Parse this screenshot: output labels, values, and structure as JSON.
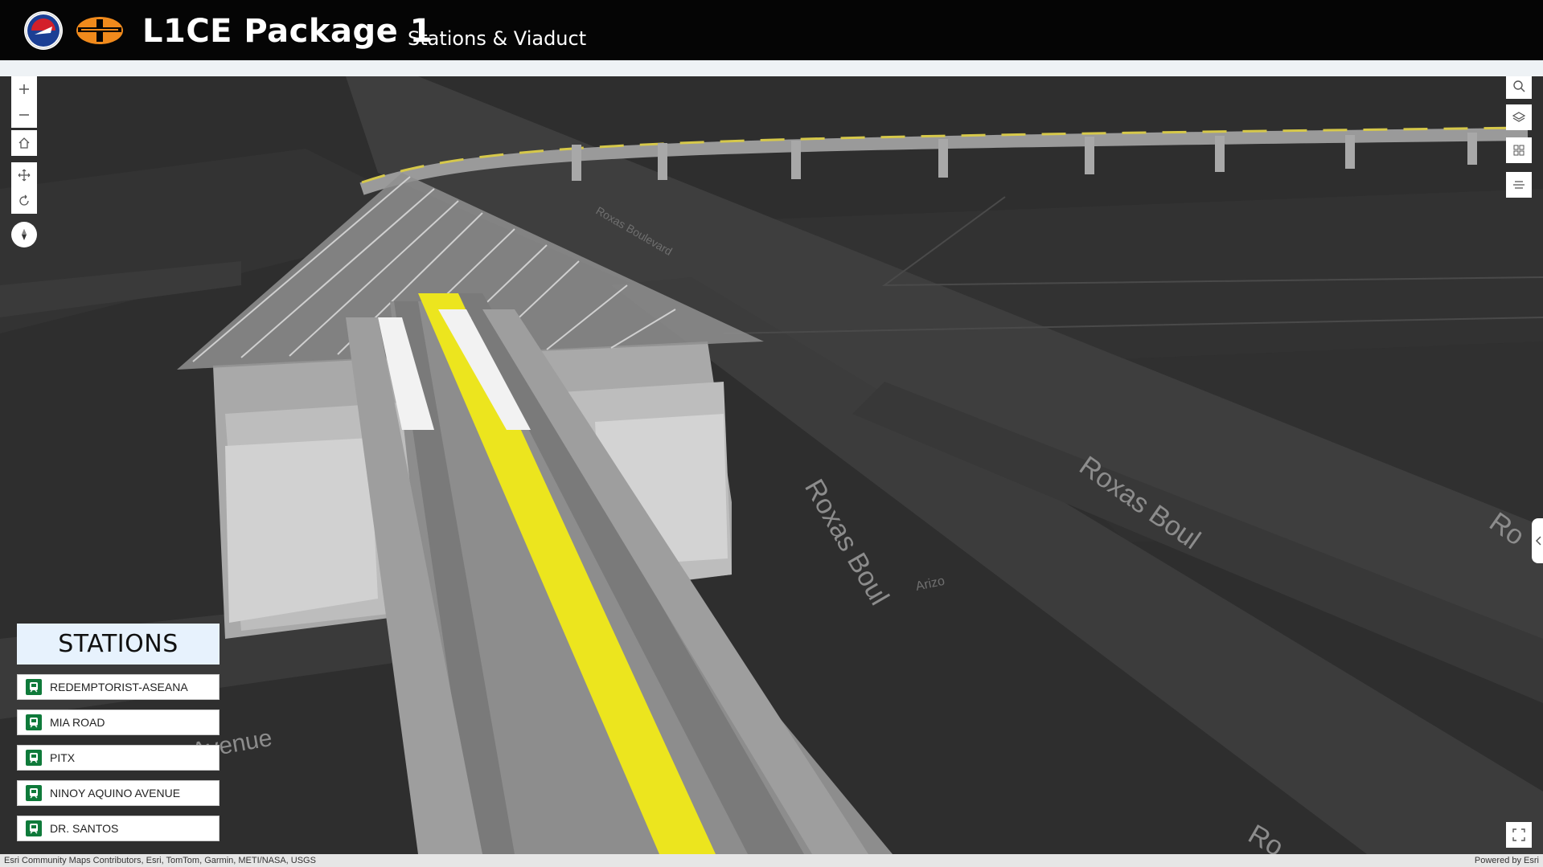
{
  "header": {
    "title": "L1CE Package 1",
    "subtitle": "Stations & Viaduct",
    "logos": [
      "dotr-seal-icon",
      "lrmc-logo-icon"
    ]
  },
  "map_controls": {
    "left": [
      "zoom-in-icon",
      "zoom-out-icon",
      "home-icon",
      "pan-icon",
      "rotate-icon",
      "compass-icon"
    ],
    "right": [
      "search-icon",
      "layers-icon",
      "basemap-gallery-icon",
      "slice-icon"
    ],
    "bottom_right": "fullscreen-icon"
  },
  "map_labels": {
    "street1": "Roxas Boul",
    "street2": "Roxas Boul",
    "street3": "Ro",
    "street4": "Ro",
    "avenue": "Avenue",
    "blvd_small": "Roxas Boulevard",
    "arizo": "Arizo"
  },
  "stations": {
    "title": "STATIONS",
    "items": [
      {
        "label": "REDEMPTORIST-ASEANA",
        "icon": "train-icon"
      },
      {
        "label": "MIA ROAD",
        "icon": "train-icon"
      },
      {
        "label": "PITX",
        "icon": "train-icon"
      },
      {
        "label": "NINOY AQUINO AVENUE",
        "icon": "train-icon"
      },
      {
        "label": "DR. SANTOS",
        "icon": "train-icon"
      }
    ]
  },
  "attribution": {
    "left": "Esri Community Maps Contributors, Esri, TomTom, Garmin, METI/NASA, USGS",
    "right": "Powered by Esri"
  },
  "colors": {
    "header_bg": "#050505",
    "map_bg": "#2e2e2e",
    "road": "#3d3d3d",
    "track_yellow": "#ece51e",
    "station_panel": "#e7f2fd",
    "station_icon": "#0f7a3a"
  }
}
